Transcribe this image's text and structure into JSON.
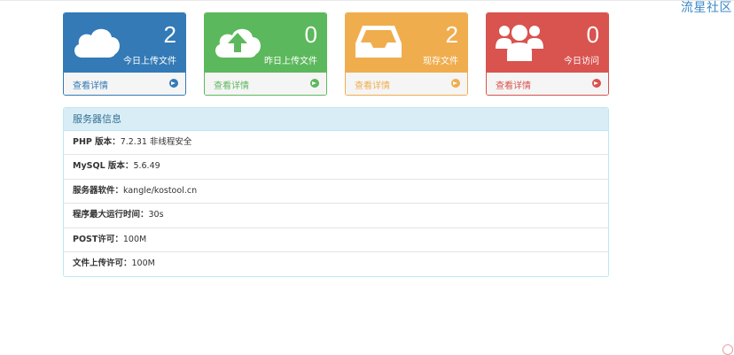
{
  "corner_link": "流星社区",
  "panels": [
    {
      "number": "2",
      "label": "今日上传文件",
      "footer": "查看详情",
      "icon": "cloud-icon",
      "color": "#337ab7",
      "footer_color": "#337ab7"
    },
    {
      "number": "0",
      "label": "昨日上传文件",
      "footer": "查看详情",
      "icon": "cloud-upload-icon",
      "color": "#5cb85c",
      "footer_color": "#5cb85c"
    },
    {
      "number": "2",
      "label": "现存文件",
      "footer": "查看详情",
      "icon": "inbox-tray-icon",
      "color": "#f0ad4e",
      "footer_color": "#f0ad4e"
    },
    {
      "number": "0",
      "label": "今日访问",
      "footer": "查看详情",
      "icon": "users-icon",
      "color": "#d9534f",
      "footer_color": "#d9534f"
    }
  ],
  "server_info": {
    "title": "服务器信息",
    "rows": [
      {
        "label": "PHP 版本：",
        "value": "7.2.31 非线程安全"
      },
      {
        "label": "MySQL 版本：",
        "value": "5.6.49"
      },
      {
        "label": "服务器软件：",
        "value": "kangle/kostool.cn"
      },
      {
        "label": "程序最大运行时间：",
        "value": "30s"
      },
      {
        "label": "POST许可：",
        "value": "100M"
      },
      {
        "label": "文件上传许可：",
        "value": "100M"
      }
    ]
  }
}
